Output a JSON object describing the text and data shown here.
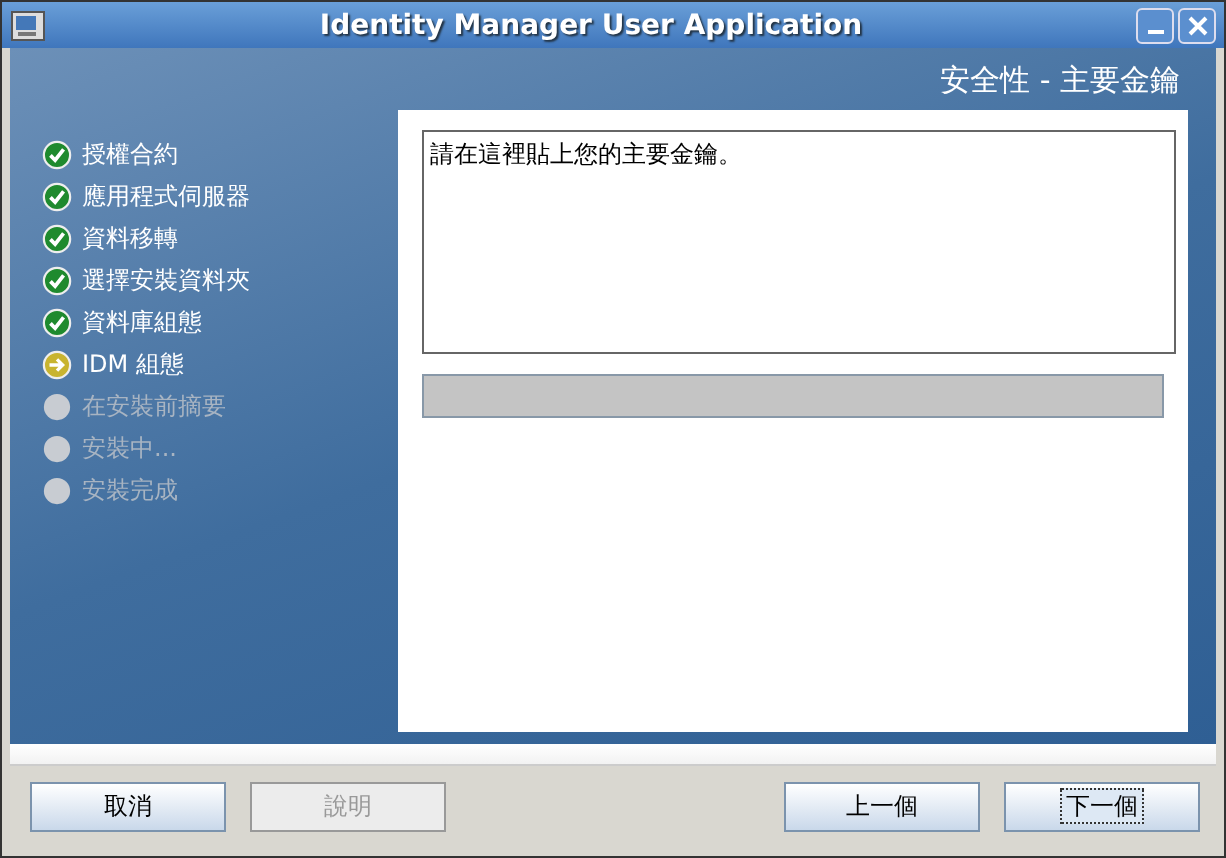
{
  "window": {
    "title": "Identity Manager User Application"
  },
  "page_title": "安全性 - 主要金鑰",
  "steps": [
    {
      "label": "授權合約",
      "kind": "done"
    },
    {
      "label": "應用程式伺服器",
      "kind": "done"
    },
    {
      "label": "資料移轉",
      "kind": "done"
    },
    {
      "label": "選擇安裝資料夾",
      "kind": "done"
    },
    {
      "label": "資料庫組態",
      "kind": "done"
    },
    {
      "label": "IDM 組態",
      "kind": "current"
    },
    {
      "label": "在安裝前摘要",
      "kind": "pending"
    },
    {
      "label": "安裝中...",
      "kind": "pending"
    },
    {
      "label": "安裝完成",
      "kind": "pending"
    }
  ],
  "key_field": {
    "value": "請在這裡貼上您的主要金鑰。"
  },
  "left_buttons": [
    {
      "label": "取消",
      "disabled": false,
      "focused": false
    },
    {
      "label": "說明",
      "disabled": true,
      "focused": false
    }
  ],
  "right_buttons": [
    {
      "label": "上一個",
      "disabled": false,
      "focused": false
    },
    {
      "label": "下一個",
      "disabled": false,
      "focused": true
    }
  ]
}
